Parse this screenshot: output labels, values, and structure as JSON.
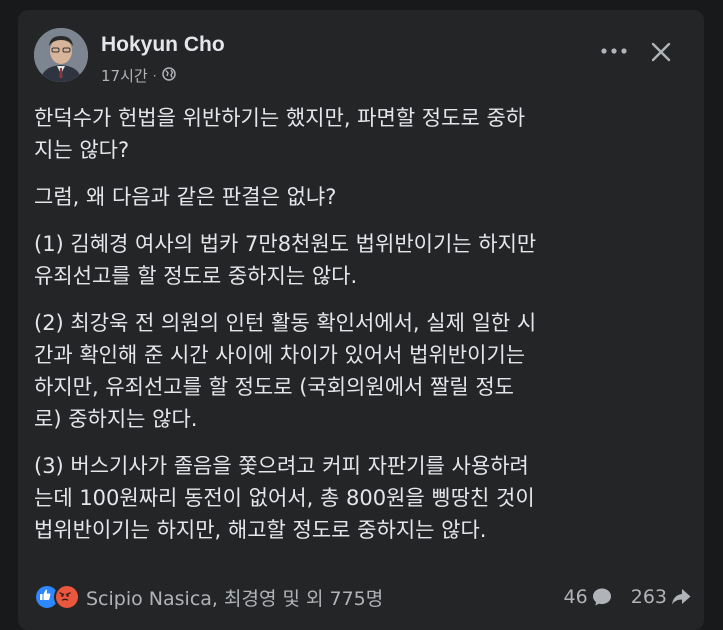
{
  "post": {
    "author": "Hokyun Cho",
    "time": "17시간",
    "separator": "·",
    "paragraphs": [
      "한덕수가 헌법을 위반하기는 했지만, 파면할 정도로 중하\n지는 않다?",
      "그럼, 왜 다음과 같은 판결은 없냐?",
      "(1) 김혜경 여사의 법카 7만8천원도 법위반이기는 하지만\n유죄선고를 할 정도로 중하지는 않다.",
      "(2) 최강욱 전 의원의 인턴 활동 확인서에서, 실제 일한 시\n간과 확인해 준 시간 사이에 차이가 있어서 법위반이기는\n하지만, 유죄선고를 할 정도로 (국회의원에서 짤릴 정도\n로) 중하지는 않다.",
      "(3) 버스기사가 졸음을 쫓으려고 커피 자판기를 사용하려\n는데 100원짜리 동전이 없어서, 총 800원을 삥땅친 것이\n법위반이기는 하지만, 해고할 정도로 중하지는 않다."
    ]
  },
  "footer": {
    "reaction_icons": [
      "like-icon",
      "angry-icon"
    ],
    "reactors": "Scipio Nasica, 최경영 및 외 775명",
    "comments": "46",
    "shares": "263"
  },
  "colors": {
    "background": "#18191a",
    "card": "#242526",
    "text": "#e4e6eb",
    "secondary": "#b0b3b8",
    "like": "#2d88ff",
    "angry": "#e9573f"
  }
}
